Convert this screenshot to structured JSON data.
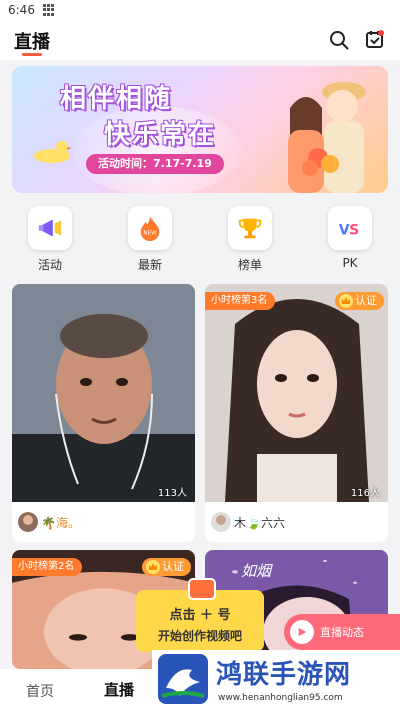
{
  "status_bar": {
    "time": "6:46"
  },
  "header": {
    "title": "直播",
    "icons": [
      "search-icon",
      "calendar-check-icon"
    ]
  },
  "banner": {
    "line1": "相伴相随",
    "line2": "快乐常在",
    "date": "活动时间：7.17-7.19"
  },
  "categories": [
    {
      "label": "活动",
      "icon": "megaphone-icon"
    },
    {
      "label": "最新",
      "icon": "flame-icon"
    },
    {
      "label": "榜单",
      "icon": "trophy-icon"
    },
    {
      "label": "PK",
      "icon": "vs-icon"
    }
  ],
  "cards": [
    {
      "name": "🌴海。",
      "viewers": "113人"
    },
    {
      "rank": "小时榜第3名",
      "badge": "认证",
      "name": "木🍃六六",
      "viewers": "116人"
    },
    {
      "rank": "小时榜第2名",
      "badge": "认证"
    },
    {
      "watermark": "如烟"
    }
  ],
  "fab_hint": {
    "line1": "点击 ＋ 号",
    "line2": "开始创作视频吧"
  },
  "live_pill": {
    "label": "直播动态"
  },
  "bottom_nav": {
    "items": [
      "首页",
      "直播"
    ]
  },
  "brand": {
    "title": "鸿联手游网",
    "url": "www.henanhonglian95.com"
  },
  "colors": {
    "accent": "#ff5a3c",
    "badge_orange": "#ff7a2a",
    "brand_blue": "#2a55b8"
  }
}
